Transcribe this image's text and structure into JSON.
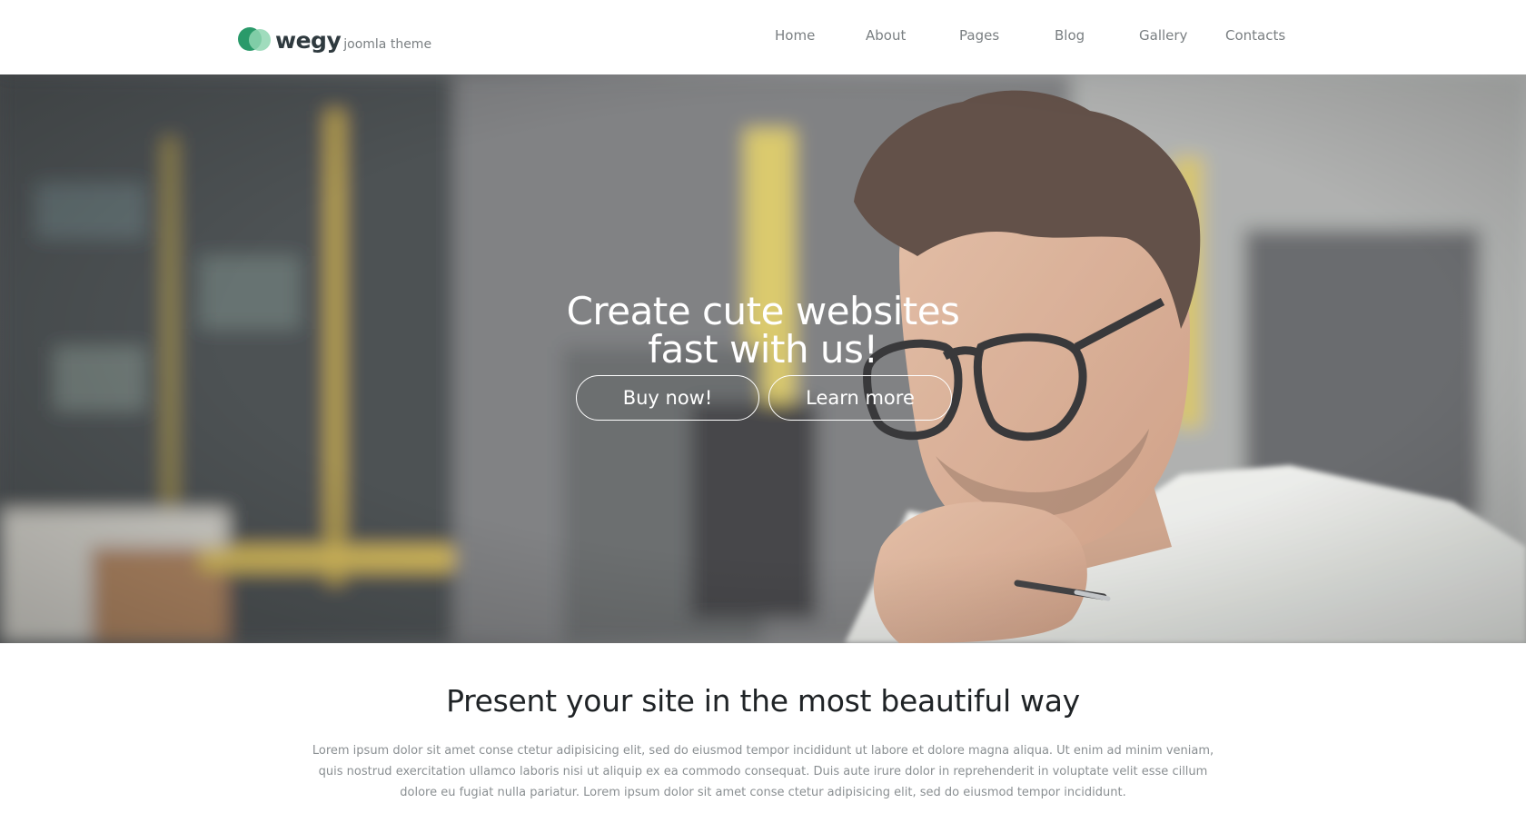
{
  "brand": {
    "name": "wegy",
    "tagline": "joomla theme",
    "accent": "#2a9a6a",
    "accent_light": "#8fd6b1"
  },
  "nav": {
    "items": [
      {
        "label": "Home"
      },
      {
        "label": "About"
      },
      {
        "label": "Pages"
      },
      {
        "label": "Blog"
      },
      {
        "label": "Gallery"
      },
      {
        "label": "Contacts"
      }
    ]
  },
  "hero": {
    "title_line1": "Create cute websites",
    "title_line2": "fast with us!",
    "buy_label": "Buy now!",
    "learn_label": "Learn more"
  },
  "intro": {
    "title": "Present your site in the most beautiful way",
    "text": "Lorem ipsum dolor sit amet conse ctetur adipisicing elit, sed do eiusmod tempor incididunt ut labore et dolore magna aliqua. Ut enim ad minim veniam, quis nostrud exercitation ullamco laboris nisi ut aliquip ex ea commodo consequat. Duis aute irure dolor in reprehenderit in voluptate velit esse cillum dolore eu fugiat nulla pariatur. Lorem ipsum dolor sit amet conse ctetur adipisicing elit, sed do eiusmod tempor incididunt."
  }
}
